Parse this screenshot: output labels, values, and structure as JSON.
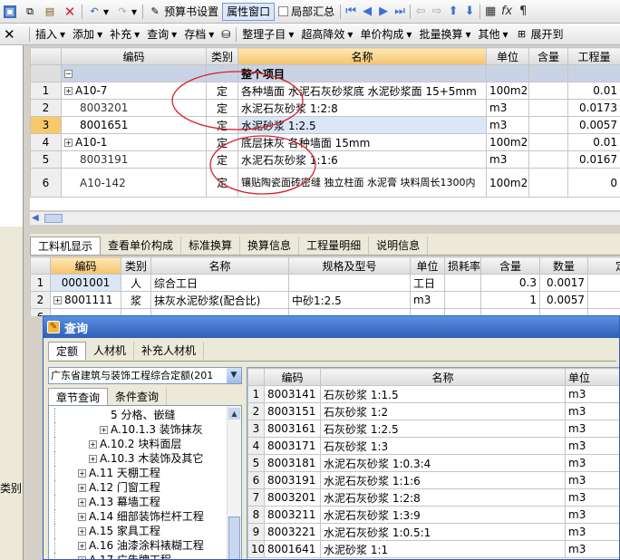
{
  "toolbar1": {
    "budget_settings": "预算书设置",
    "property_window": "属性窗口",
    "partial_summary": "局部汇总"
  },
  "toolbar2": {
    "items": [
      "插入",
      "添加",
      "补充",
      "查询",
      "存档"
    ],
    "items2": [
      "整理子目",
      "超高降效",
      "单价构成",
      "批量换算",
      "其他"
    ],
    "expand": "展开到"
  },
  "main_table": {
    "headers": [
      "编码",
      "类别",
      "名称",
      "单位",
      "含量",
      "工程量"
    ],
    "group_title": "整个项目",
    "rows": [
      {
        "no": "1",
        "code": "A10-7",
        "type": "定",
        "name": "各种墙面 水泥石灰砂浆底 水泥砂浆面 15+5mm",
        "unit": "100m2",
        "content": "",
        "qty": "0.01"
      },
      {
        "no": "2",
        "code": "8003201",
        "type": "定",
        "name": "水泥石灰砂浆 1:2:8",
        "unit": "m3",
        "content": "",
        "qty": "0.0173"
      },
      {
        "no": "3",
        "code": "8001651",
        "type": "定",
        "name": "水泥砂浆 1:2.5",
        "unit": "m3",
        "content": "",
        "qty": "0.0057"
      },
      {
        "no": "4",
        "code": "A10-1",
        "type": "定",
        "name": "底层抹灰 各种墙面 15mm",
        "unit": "100m2",
        "content": "",
        "qty": "0.01"
      },
      {
        "no": "5",
        "code": "8003191",
        "type": "定",
        "name": "水泥石灰砂浆 1:1:6",
        "unit": "m3",
        "content": "",
        "qty": "0.0167"
      },
      {
        "no": "6",
        "code": "A10-142",
        "type": "定",
        "name": "镶贴陶瓷面砖密缝 独立柱面 水泥膏 块料周长1300内",
        "unit": "100m2",
        "content": "",
        "qty": "0"
      }
    ]
  },
  "bottom_tabs": [
    "工料机显示",
    "查看单价构成",
    "标准换算",
    "换算信息",
    "工程量明细",
    "说明信息"
  ],
  "material_table": {
    "headers": [
      "编码",
      "类别",
      "名称",
      "规格及型号",
      "单位",
      "损耗率",
      "含量",
      "数量",
      "定额"
    ],
    "rows": [
      {
        "no": "1",
        "code": "0001001",
        "type": "人",
        "name": "综合工日",
        "spec": "",
        "unit": "工日",
        "loss": "",
        "content": "0.3",
        "qty": "0.0017",
        "price": ""
      },
      {
        "no": "2",
        "code": "8001111",
        "type": "浆",
        "name": "抹灰水泥砂浆(配合比)",
        "spec": "中砂1:2.5",
        "unit": "m3",
        "loss": "",
        "content": "1",
        "qty": "0.0057",
        "price": "20"
      }
    ],
    "row3_no": "6"
  },
  "left_panel": {
    "label": "类别"
  },
  "query_dialog": {
    "title": "查询",
    "tabs": [
      "定额",
      "人材机",
      "补充人材机"
    ],
    "library": "广东省建筑与装饰工程综合定额(201",
    "subtabs": [
      "章节查询",
      "条件查询"
    ],
    "tree": [
      {
        "text": "5 分格、嵌缝",
        "level": 4,
        "expander": false
      },
      {
        "text": "A.10.1.3 装饰抹灰",
        "level": 3,
        "expander": true
      },
      {
        "text": "A.10.2 块料面层",
        "level": 2,
        "expander": true
      },
      {
        "text": "A.10.3 木装饰及其它",
        "level": 2,
        "expander": true
      },
      {
        "text": "A.11 天棚工程",
        "level": 1,
        "expander": true
      },
      {
        "text": "A.12 门窗工程",
        "level": 1,
        "expander": true
      },
      {
        "text": "A.13 幕墙工程",
        "level": 1,
        "expander": true
      },
      {
        "text": "A.14 细部装饰栏杆工程",
        "level": 1,
        "expander": true
      },
      {
        "text": "A.15 家具工程",
        "level": 1,
        "expander": true
      },
      {
        "text": "A.16 油漆涂料裱糊工程",
        "level": 1,
        "expander": true
      },
      {
        "text": "A.17 广告牌工程",
        "level": 1,
        "expander": true
      }
    ],
    "result_headers": [
      "编码",
      "名称",
      "单位"
    ],
    "results": [
      {
        "no": "1",
        "code": "8003141",
        "name": "石灰砂浆 1:1.5",
        "unit": "m3"
      },
      {
        "no": "2",
        "code": "8003151",
        "name": "石灰砂浆 1:2",
        "unit": "m3"
      },
      {
        "no": "3",
        "code": "8003161",
        "name": "石灰砂浆 1:2.5",
        "unit": "m3"
      },
      {
        "no": "4",
        "code": "8003171",
        "name": "石灰砂浆 1:3",
        "unit": "m3"
      },
      {
        "no": "5",
        "code": "8003181",
        "name": "水泥石灰砂浆 1:0.3:4",
        "unit": "m3"
      },
      {
        "no": "6",
        "code": "8003191",
        "name": "水泥石灰砂浆 1:1:6",
        "unit": "m3"
      },
      {
        "no": "7",
        "code": "8003201",
        "name": "水泥石灰砂浆 1:2:8",
        "unit": "m3"
      },
      {
        "no": "8",
        "code": "8003211",
        "name": "水泥石灰砂浆 1:3:9",
        "unit": "m3"
      },
      {
        "no": "9",
        "code": "8003221",
        "name": "水泥石灰砂浆 1:0.5:1",
        "unit": "m3"
      },
      {
        "no": "10",
        "code": "8001641",
        "name": "水泥砂浆 1:1",
        "unit": "m3"
      }
    ]
  },
  "colors": {
    "annotation": "#d8202a",
    "highlight": "#f7c96a",
    "title_bar": "#2f5fb8"
  }
}
